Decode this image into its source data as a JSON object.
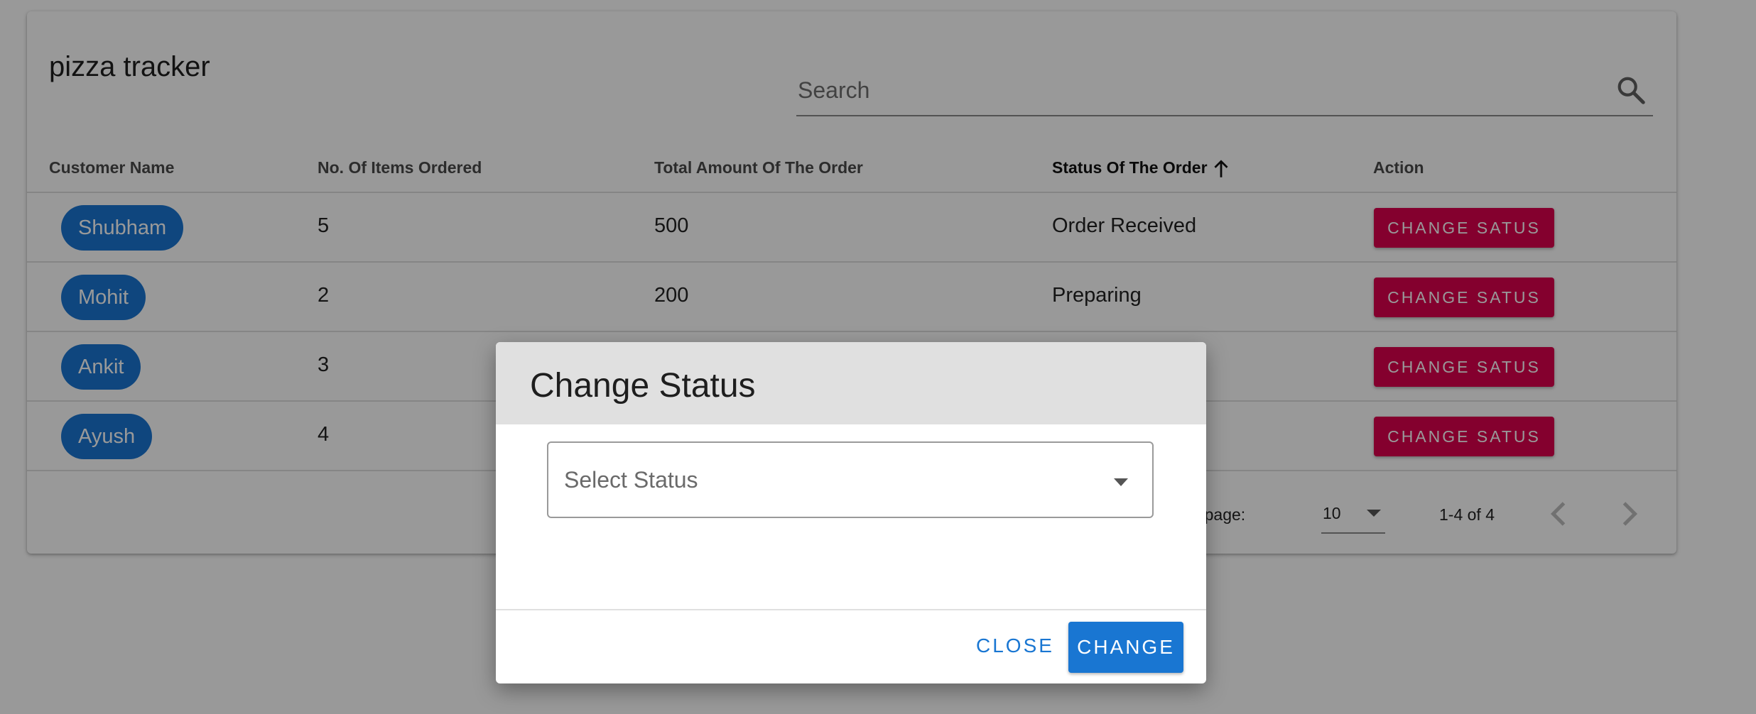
{
  "app": {
    "title": "pizza tracker",
    "search_placeholder": "Search"
  },
  "table": {
    "columns": [
      "Customer Name",
      "No. Of Items Ordered",
      "Total Amount Of The Order",
      "Status Of The Order",
      "Action"
    ],
    "sorted_column": "Status Of The Order",
    "sort_direction": "ascending",
    "rows": [
      {
        "customer": "Shubham",
        "items": "5",
        "amount": "500",
        "status": "Order Received",
        "action": "CHANGE SATUS"
      },
      {
        "customer": "Mohit",
        "items": "2",
        "amount": "200",
        "status": "Preparing",
        "action": "CHANGE SATUS"
      },
      {
        "customer": "Ankit",
        "items": "3",
        "amount": "",
        "status": "",
        "action": "CHANGE SATUS"
      },
      {
        "customer": "Ayush",
        "items": "4",
        "amount": "",
        "status": "",
        "action": "CHANGE SATUS"
      }
    ]
  },
  "pagination": {
    "rows_per_page_label": "ber page:",
    "rows_per_page_value": "10",
    "range": "1-4 of 4"
  },
  "dialog": {
    "title": "Change Status",
    "select_placeholder": "Select Status",
    "close_label": "CLOSE",
    "confirm_label": "CHANGE"
  },
  "colors": {
    "primary": "#1976d2",
    "secondary": "#dc004e",
    "backdrop": "rgba(0,0,0,0.4)"
  },
  "icons": {
    "search": "search-icon",
    "sort": "arrow-up-icon",
    "select_caret": "caret-down-icon",
    "prev_page": "chevron-left-icon",
    "next_page": "chevron-right-icon"
  }
}
